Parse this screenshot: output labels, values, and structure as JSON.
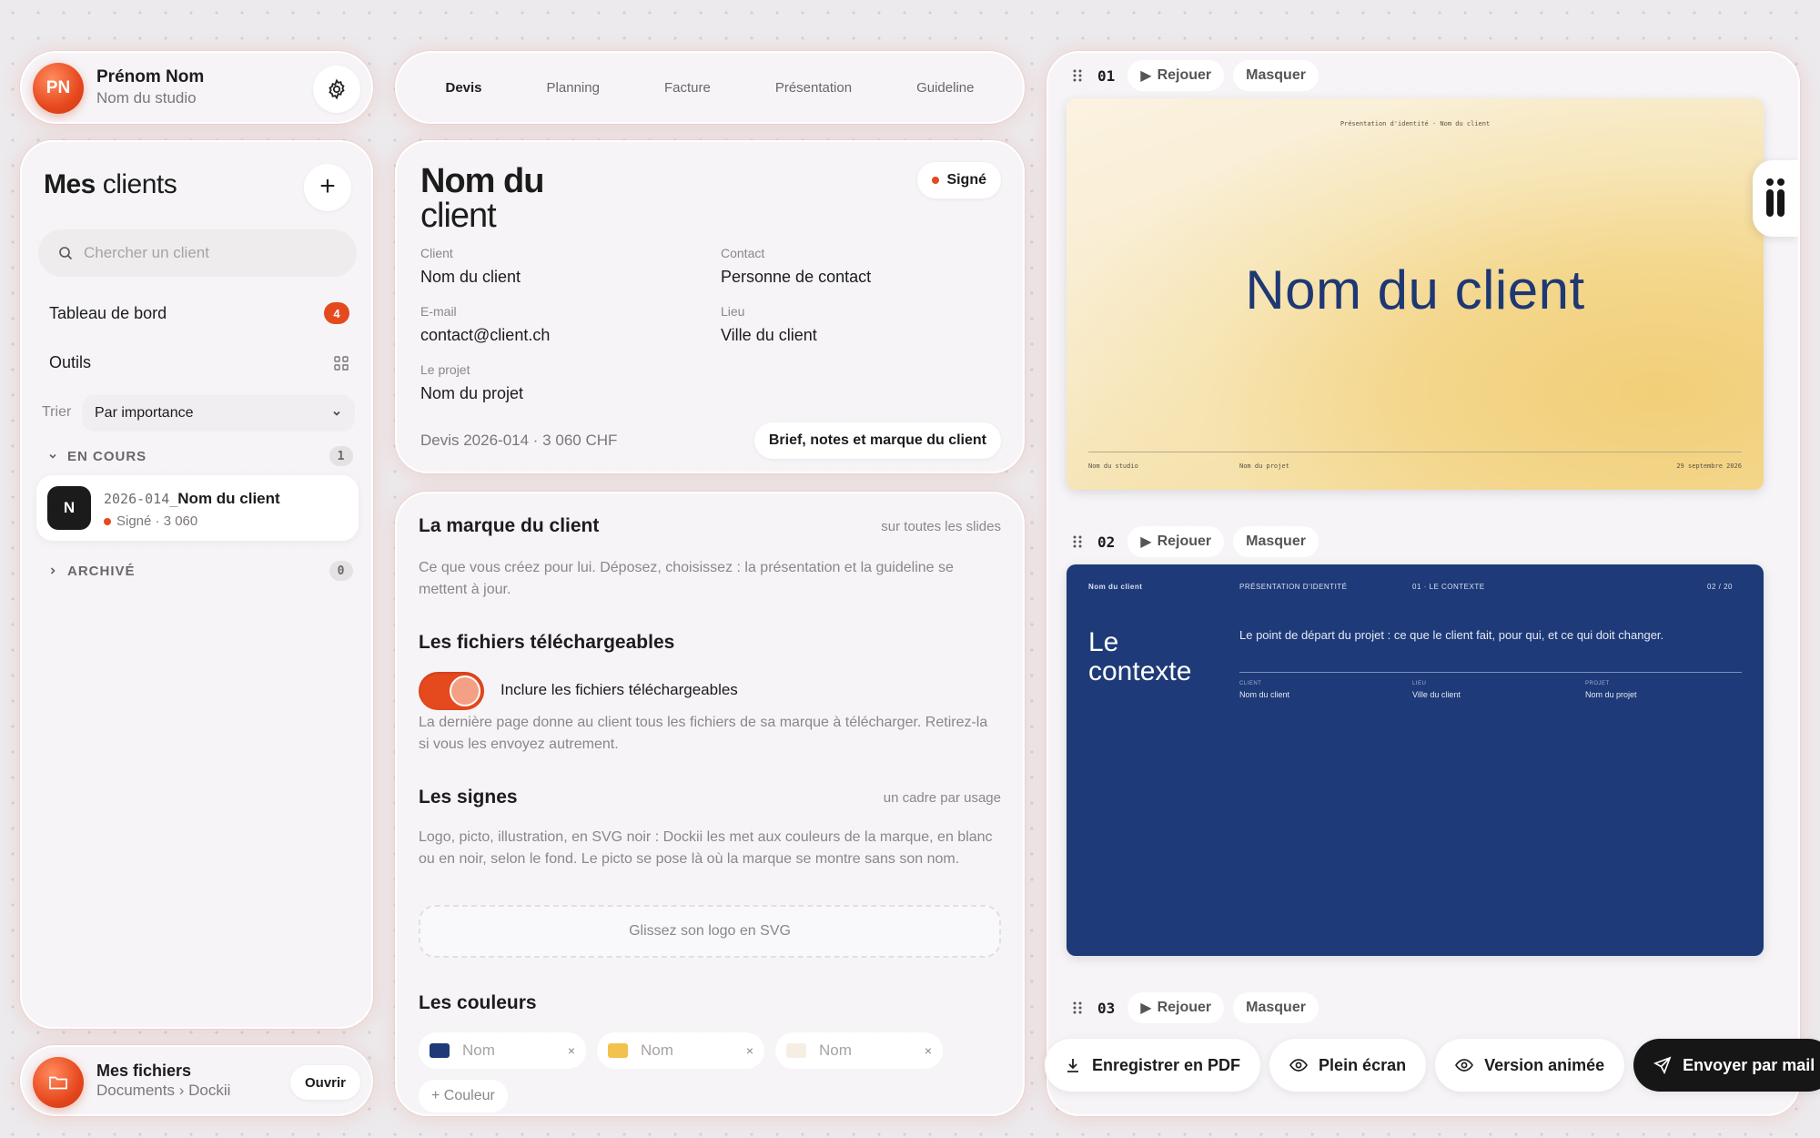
{
  "profile": {
    "initials": "PN",
    "name": "Prénom Nom",
    "studio": "Nom du studio"
  },
  "clients": {
    "title_bold": "Mes",
    "title_rest": " clients",
    "search_placeholder": "Chercher un client",
    "dashboard_label": "Tableau de bord",
    "dashboard_badge": "4",
    "tools_label": "Outils",
    "sort_label": "Trier",
    "sort_value": "Par importance",
    "group_current": {
      "label": "EN COURS",
      "count": "1"
    },
    "group_archived": {
      "label": "ARCHIVÉ",
      "count": "0"
    },
    "client_item": {
      "initial": "N",
      "code": "2026-014_",
      "name": "Nom du client",
      "status": "Signé · 3 060"
    }
  },
  "files": {
    "title": "Mes fichiers",
    "path": "Documents › Dockii",
    "open_label": "Ouvrir"
  },
  "tabs": [
    "Devis",
    "Planning",
    "Facture",
    "Présentation",
    "Guideline"
  ],
  "client_info": {
    "name_line1": "Nom du",
    "name_line2": "client",
    "status": "Signé",
    "client_label": "Client",
    "client_value": "Nom du client",
    "contact_label": "Contact",
    "contact_value": "Personne de contact",
    "email_label": "E-mail",
    "email_value": "contact@client.ch",
    "place_label": "Lieu",
    "place_value": "Ville du client",
    "project_label": "Le projet",
    "project_value": "Nom du projet",
    "quote": "Devis 2026-014 · 3 060 CHF",
    "brief_button": "Brief, notes et marque du client"
  },
  "brand": {
    "title": "La marque du client",
    "aside": "sur toutes les slides",
    "text": "Ce que vous créez pour lui. Déposez, choisissez : la présentation et la guideline se mettent à jour.",
    "downloads_title": "Les fichiers téléchargeables",
    "toggle_label": "Inclure les fichiers téléchargeables",
    "downloads_text": "La dernière page donne au client tous les fichiers de sa marque à télécharger. Retirez-la si vous les envoyez autrement.",
    "signs_title": "Les signes",
    "signs_aside": "un cadre par usage",
    "signs_text": "Logo, picto, illustration, en SVG noir : Dockii les met aux couleurs de la marque, en blanc ou en noir, selon le fond. Le picto se pose là où la marque se montre sans son nom.",
    "dropzone": "Glissez son logo en SVG",
    "colors_title": "Les couleurs",
    "color_placeholder": "Nom",
    "color_chips": [
      {
        "color": "#1e3a78"
      },
      {
        "color": "#f2c14e"
      },
      {
        "color": "#f6eee2"
      }
    ],
    "add_color": "+ Couleur"
  },
  "slides": {
    "replay": "Rejouer",
    "hide": "Masquer",
    "numbers": [
      "01",
      "02",
      "03"
    ],
    "s1": {
      "top": "Présentation d'identité · Nom du client",
      "title": "Nom du client",
      "footer_left": "Nom du studio",
      "footer_mid": "Nom du projet",
      "footer_right": "29 septembre 2026"
    },
    "s2": {
      "client": "Nom du client",
      "kind": "PRÉSENTATION D'IDENTITÉ",
      "section": "01 · LE CONTEXTE",
      "page": "02 / 20",
      "title_l1": "Le",
      "title_l2": "contexte",
      "lead": "Le point de départ du projet : ce que le client fait, pour qui, et ce qui doit changer.",
      "k1": "CLIENT",
      "v1": "Nom du client",
      "k2": "LIEU",
      "v2": "Ville du client",
      "k3": "PROJET",
      "v3": "Nom du projet"
    }
  },
  "actions": {
    "pdf": "Enregistrer en PDF",
    "fullscreen": "Plein écran",
    "animated": "Version animée",
    "mail": "Envoyer par mail"
  },
  "colors": {
    "accent": "#e5491e",
    "navy": "#1e3a78",
    "dark": "#161616"
  }
}
